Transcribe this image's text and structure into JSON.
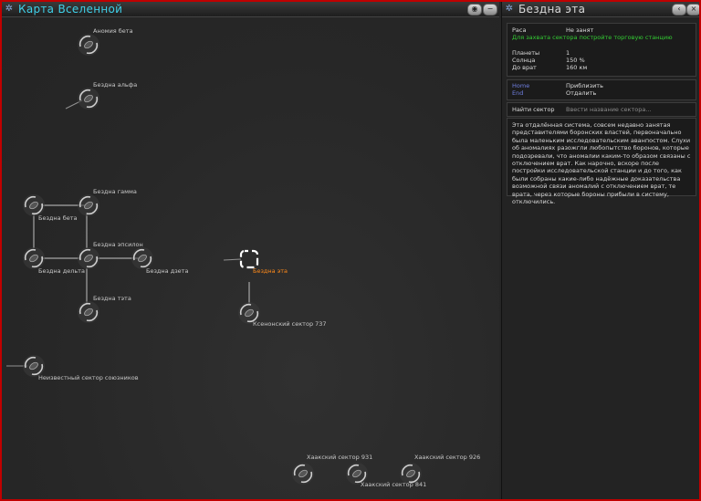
{
  "map": {
    "title": "Карта Вселенной",
    "buttons": [
      "eye-icon",
      "minus-icon"
    ],
    "nodes": [
      {
        "label": "Аномия бета"
      },
      {
        "label": "Бездна альфа"
      },
      {
        "label": "Бездна гамма"
      },
      {
        "label": "Бездна бета"
      },
      {
        "label": "Бездна эпсилон"
      },
      {
        "label": "Бездна дельта"
      },
      {
        "label": "Бездна дзета"
      },
      {
        "label": "Бездна эта"
      },
      {
        "label": "Бездна тэта"
      },
      {
        "label": "Ксенонский сектор 737"
      },
      {
        "label": "Неизвестный сектор союзников"
      },
      {
        "label": "Хаакский сектор 931"
      },
      {
        "label": "Хаакский сектор 926"
      },
      {
        "label": "Хаакский сектор 841"
      }
    ]
  },
  "panel": {
    "title": "Бездна эта",
    "info": {
      "race_label": "Раса",
      "race_value": "Не занят",
      "capture_hint": "Для захвата сектора постройте торговую станцию",
      "planets_label": "Планеты",
      "planets_value": "1",
      "suns_label": "Солнца",
      "suns_value": "150 %",
      "gate_label": "До врат",
      "gate_value": "160 км"
    },
    "zoom": {
      "home_key": "Home",
      "home_action": "Приблизить",
      "end_key": "End",
      "end_action": "Отдалить"
    },
    "search": {
      "label": "Найти сектор",
      "placeholder": "Ввести название сектора..."
    },
    "description": "Эта отдалённая система, совсем недавно занятая представителями боронских властей, первоначально была маленьким исследовательским аванпостом. Слухи об аномалиях разожгли любопытство боронов, которые подозревали, что аномалии каким-то образом связаны с отключением врат. Как нарочно, вскоре после постройки исследовательской станции и до того, как были собраны какие-либо надёжные доказательства возможной связи аномалий с отключением врат, те врата, через которые бороны прибыли в систему, отключились."
  },
  "colors": {
    "title_cyan": "#3fd0e8",
    "selected_orange": "#ff8a1a",
    "hint_green": "#33cc33",
    "key_blue": "#6f7fe0",
    "frame_red": "#c00000"
  }
}
